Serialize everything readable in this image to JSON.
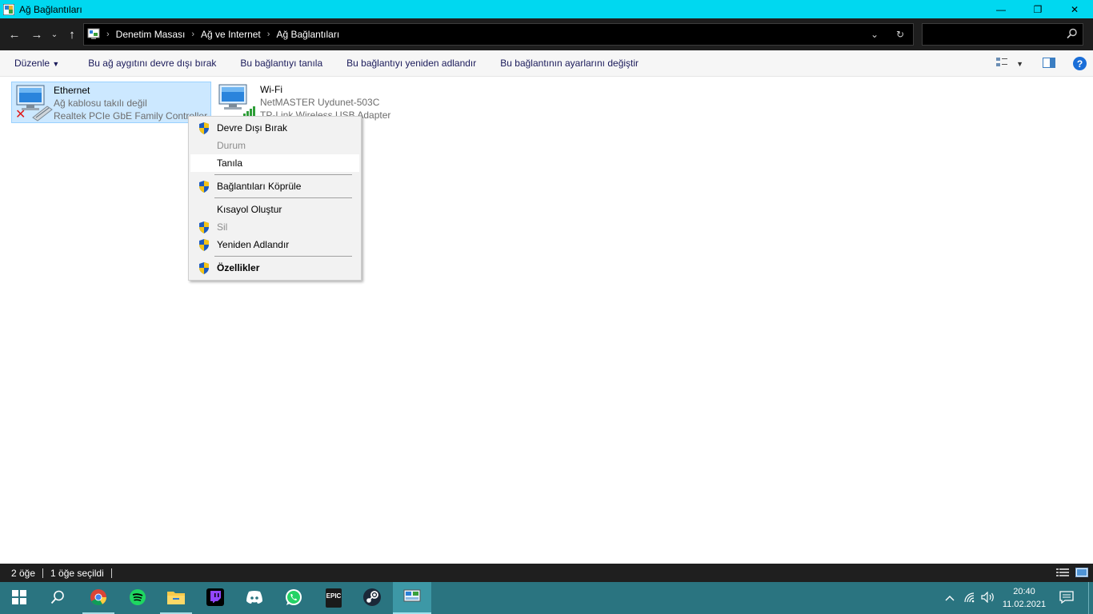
{
  "window": {
    "title": "Ağ Bağlantıları",
    "minimize_label": "—",
    "maximize_label": "❐",
    "close_label": "✕"
  },
  "address": {
    "back_label": "←",
    "forward_label": "→",
    "recent_label": "⌄",
    "up_label": "↑",
    "breadcrumbs": [
      "Denetim Masası",
      "Ağ ve Internet",
      "Ağ Bağlantıları"
    ],
    "sep": "›",
    "dropdown_label": "⌄",
    "refresh_label": "↻",
    "search_placeholder": ""
  },
  "commandbar": {
    "organize": "Düzenle",
    "disable": "Bu ağ aygıtını devre dışı bırak",
    "diagnose": "Bu bağlantıyı tanıla",
    "rename": "Bu bağlantıyı yeniden adlandır",
    "settings": "Bu bağlantının ayarlarını değiştir",
    "help_label": "?"
  },
  "connections": [
    {
      "name": "Ethernet",
      "status": "Ağ kablosu takılı değil",
      "device": "Realtek PCIe GbE Family Controller",
      "selected": true
    },
    {
      "name": "Wi-Fi",
      "status": "NetMASTER Uydunet-503C",
      "device": "TP-Link Wireless USB Adapter",
      "selected": false
    }
  ],
  "context_menu": {
    "items": [
      {
        "label": "Devre Dışı Bırak",
        "shield": true,
        "disabled": false
      },
      {
        "label": "Durum",
        "shield": false,
        "disabled": true
      },
      {
        "label": "Tanıla",
        "shield": false,
        "disabled": false,
        "hover": true
      },
      {
        "label": "Bağlantıları Köprüle",
        "shield": true,
        "disabled": false
      },
      {
        "label": "Kısayol Oluştur",
        "shield": false,
        "disabled": false
      },
      {
        "label": "Sil",
        "shield": true,
        "disabled": true
      },
      {
        "label": "Yeniden Adlandır",
        "shield": true,
        "disabled": false
      },
      {
        "label": "Özellikler",
        "shield": true,
        "disabled": false,
        "bold": true
      }
    ]
  },
  "statusbar": {
    "count": "2 öğe",
    "selected": "1 öğe seçildi"
  },
  "taskbar": {
    "apps": [
      "start-icon",
      "search-icon",
      "chrome-icon",
      "spotify-icon",
      "file-explorer-icon",
      "twitch-icon",
      "discord-icon",
      "whatsapp-icon",
      "epic-games-icon",
      "steam-icon",
      "network-connections-icon"
    ],
    "epic_text": "EPIC",
    "time": "20:40",
    "date": "11.02.2021"
  },
  "colors": {
    "titlebar": "#00d8f0",
    "taskbar": "#2a7480",
    "selection": "#cce8ff",
    "shield_blue": "#1c5bbf",
    "shield_yellow": "#f4c417"
  }
}
